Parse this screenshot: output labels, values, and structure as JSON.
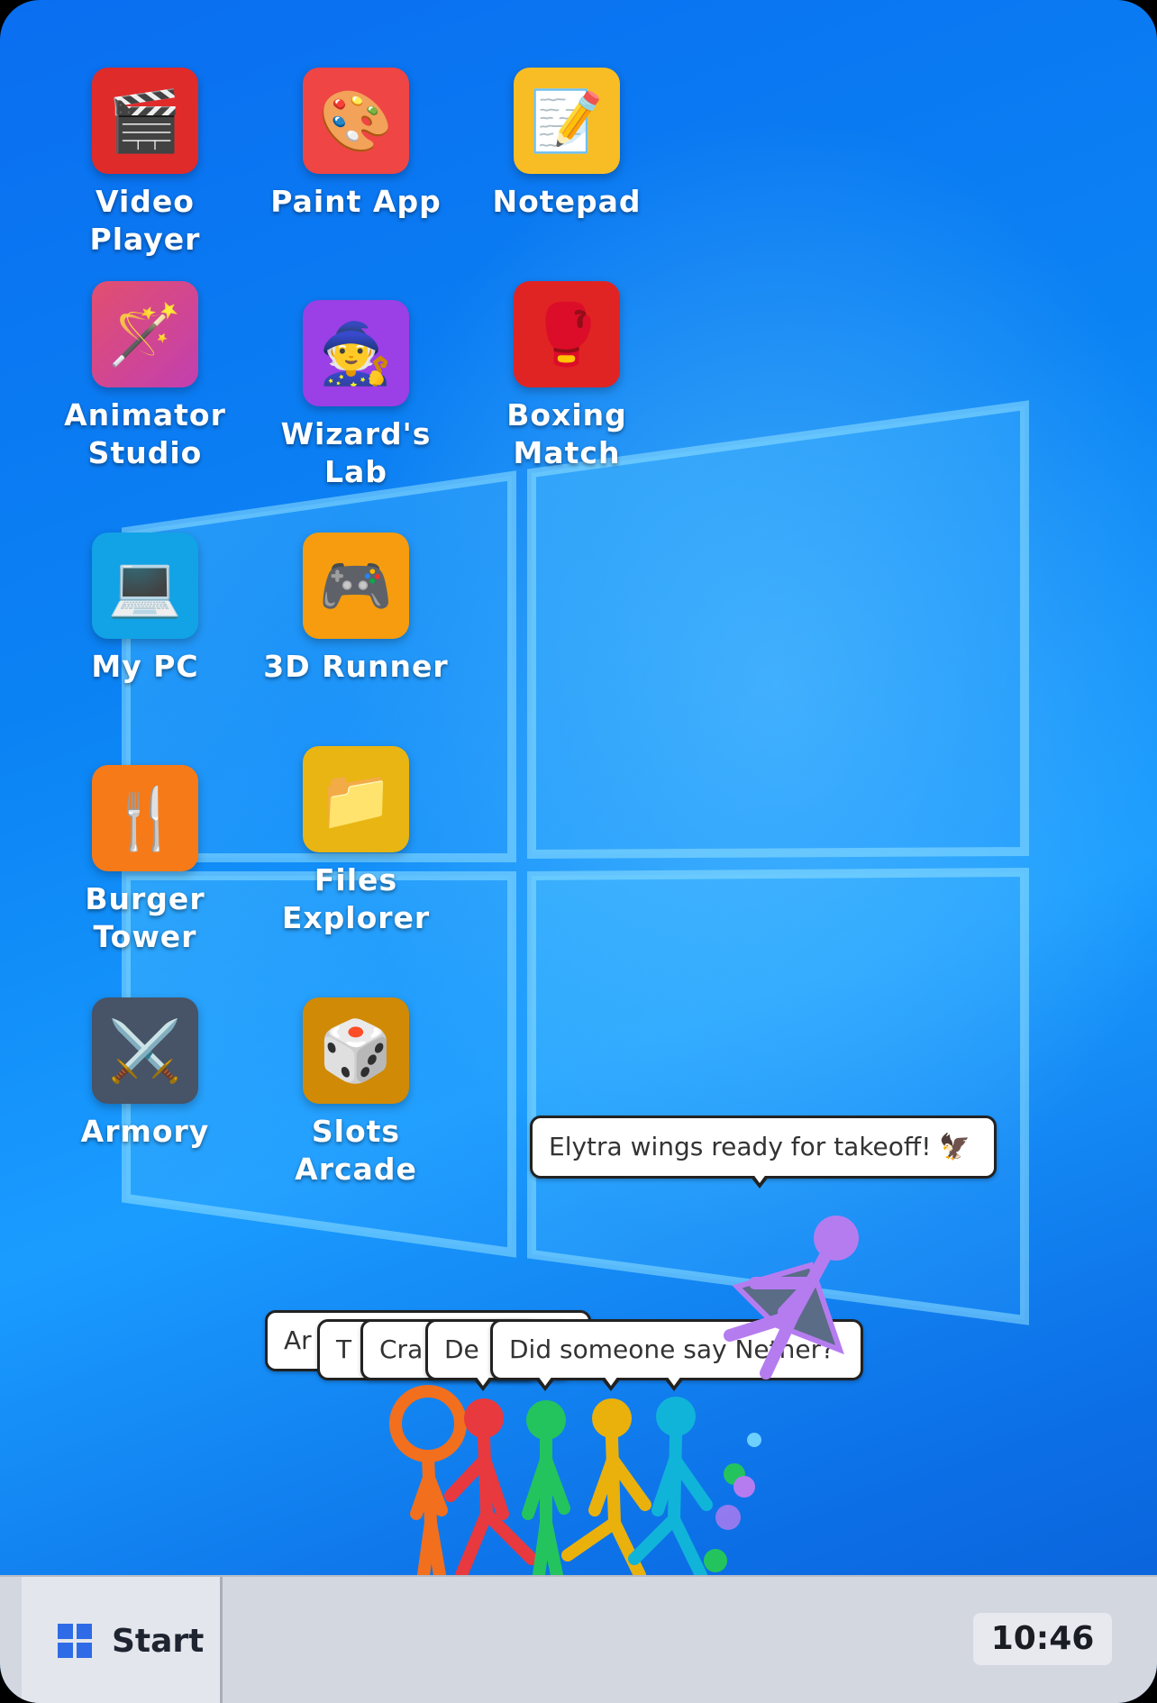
{
  "desktop": {
    "apps": [
      {
        "label": "Video Player",
        "icon": "clapperboard-icon",
        "glyph": "🎬",
        "color": "#e02b2b"
      },
      {
        "label": "Paint App",
        "icon": "palette-icon",
        "glyph": "🎨",
        "color": "#ef4545"
      },
      {
        "label": "Notepad",
        "icon": "memo-icon",
        "glyph": "📝",
        "color": "#f8bd24"
      },
      {
        "label": "Animator\nStudio",
        "icon": "magic-wand-icon",
        "glyph": "🪄",
        "color": "#d9488c"
      },
      {
        "label": "Wizard's Lab",
        "icon": "wizard-icon",
        "glyph": "🧙",
        "color": "#9b3fe6"
      },
      {
        "label": "Boxing\nMatch",
        "icon": "boxing-glove-icon",
        "glyph": "🥊",
        "color": "#e02424"
      },
      {
        "label": "My PC",
        "icon": "laptop-icon",
        "glyph": "💻",
        "color": "#12a2e6"
      },
      {
        "label": "3D Runner",
        "icon": "gamepad-icon",
        "glyph": "🎮",
        "color": "#f69c0e"
      },
      {
        "label": "Burger Tower",
        "icon": "fork-knife-icon",
        "glyph": "🍴",
        "color": "#f77a18"
      },
      {
        "label": "Files\nExplorer",
        "icon": "folder-icon",
        "glyph": "📁",
        "color": "#e8b513"
      },
      {
        "label": "Armory",
        "icon": "crossed-swords-icon",
        "glyph": "⚔️",
        "color": "#475366"
      },
      {
        "label": "Slots Arcade",
        "icon": "dice-icon",
        "glyph": "🎲",
        "color": "#d08a06"
      }
    ]
  },
  "speech": {
    "elytra": "Elytra wings ready for takeoff! 🦅",
    "b1": "Ar",
    "b2": "T",
    "b3": "Cra",
    "b4": "De",
    "b5": "Did someone say Nether?"
  },
  "colors": {
    "orange_figure": "#f26f1e",
    "red_figure": "#e8393f",
    "green_figure": "#23c45e",
    "yellow_figure": "#eab10c",
    "cyan_figure": "#10b4d8",
    "purple_figure": "#b57cf0"
  },
  "taskbar": {
    "start_label": "Start",
    "clock": "10:46"
  }
}
